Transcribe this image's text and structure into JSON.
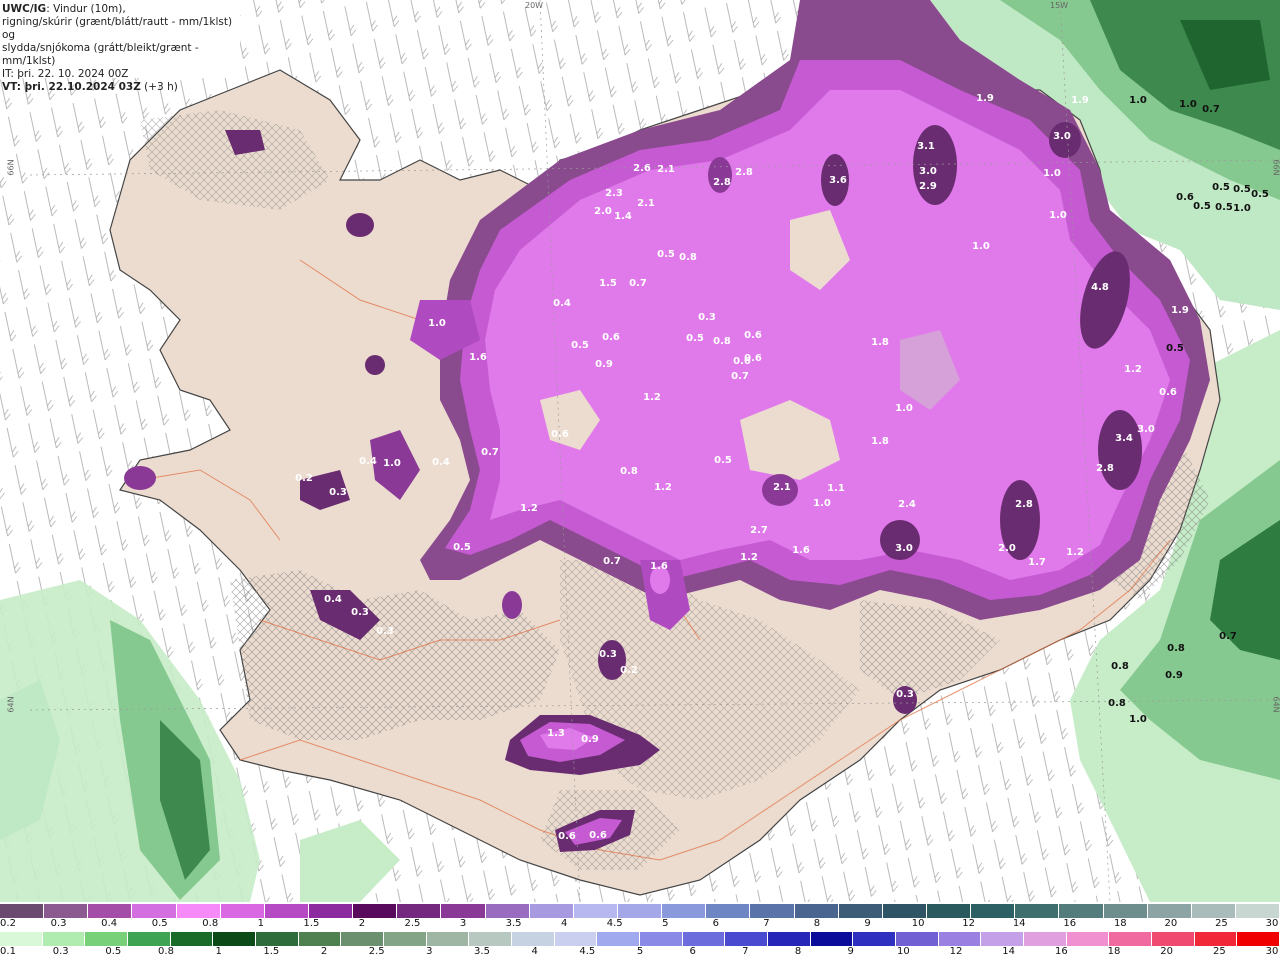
{
  "header": {
    "model": "UWC/IG",
    "line1_rest": ": Vindur (10m),",
    "line2": "rigning/skúrir (grænt/blátt/rautt - mm/1klst) og",
    "line3": "slydda/snjókoma (grátt/bleikt/grænt - mm/1klst)",
    "init_time": "IT: þri. 22. 10. 2024 00Z",
    "valid_time": "VT: þri. 22.10.2024 03Z",
    "lead": "(+3 h)"
  },
  "grid_labels": {
    "lon_20w": "20W",
    "lon_15w": "15W",
    "lat_66n_left": "66N",
    "lat_66n_right": "66N",
    "lat_64n_left": "64N",
    "lat_64n_right": "64N"
  },
  "colors": {
    "land": "#ecdcd0",
    "roads": "#e06030",
    "snow_purple": "#dd6ee8",
    "snow_dark": "#6a2c70",
    "snow_mid": "#a24aa8",
    "rain_green_light": "#b8ecc0",
    "rain_green_dark": "#2e7c40"
  },
  "precip_labels": [
    {
      "t": "3.1",
      "c": "w"
    },
    {
      "t": "3.0",
      "c": "w"
    },
    {
      "t": "2.9",
      "c": "w"
    },
    {
      "t": "3.6",
      "c": "w"
    },
    {
      "t": "2.8",
      "c": "w"
    },
    {
      "t": "2.8",
      "c": "w"
    },
    {
      "t": "2.6",
      "c": "w"
    },
    {
      "t": "2.1",
      "c": "w"
    },
    {
      "t": "2.3",
      "c": "w"
    },
    {
      "t": "2.0",
      "c": "w"
    },
    {
      "t": "1.4",
      "c": "w"
    },
    {
      "t": "2.1",
      "c": "w"
    },
    {
      "t": "1.9",
      "c": "w"
    },
    {
      "t": "1.9",
      "c": "w"
    },
    {
      "t": "3.0",
      "c": "w"
    },
    {
      "t": "1.0",
      "c": "w"
    },
    {
      "t": "1.0",
      "c": "w"
    },
    {
      "t": "1.0",
      "c": "w"
    },
    {
      "t": "4.8",
      "c": "w"
    },
    {
      "t": "1.9",
      "c": "w"
    },
    {
      "t": "3.4",
      "c": "w"
    },
    {
      "t": "3.0",
      "c": "w"
    },
    {
      "t": "2.8",
      "c": "w"
    },
    {
      "t": "2.8",
      "c": "w"
    },
    {
      "t": "2.0",
      "c": "w"
    },
    {
      "t": "1.7",
      "c": "w"
    },
    {
      "t": "1.2",
      "c": "w"
    },
    {
      "t": "2.4",
      "c": "w"
    },
    {
      "t": "3.0",
      "c": "w"
    },
    {
      "t": "2.1",
      "c": "w"
    },
    {
      "t": "2.7",
      "c": "w"
    },
    {
      "t": "1.0",
      "c": "w"
    },
    {
      "t": "1.1",
      "c": "w"
    },
    {
      "t": "1.2",
      "c": "w"
    },
    {
      "t": "1.6",
      "c": "w"
    },
    {
      "t": "1.8",
      "c": "w"
    },
    {
      "t": "1.8",
      "c": "w"
    },
    {
      "t": "1.0",
      "c": "w"
    },
    {
      "t": "1.2",
      "c": "w"
    },
    {
      "t": "0.5",
      "c": "w"
    },
    {
      "t": "0.8",
      "c": "w"
    },
    {
      "t": "1.2",
      "c": "w"
    },
    {
      "t": "1.2",
      "c": "w"
    },
    {
      "t": "1.6",
      "c": "w"
    },
    {
      "t": "1.0",
      "c": "w"
    },
    {
      "t": "0.7",
      "c": "w"
    },
    {
      "t": "0.5",
      "c": "w"
    },
    {
      "t": "0.4",
      "c": "w"
    },
    {
      "t": "1.0",
      "c": "w"
    },
    {
      "t": "0.4",
      "c": "w"
    },
    {
      "t": "0.3",
      "c": "w"
    },
    {
      "t": "0.2",
      "c": "w"
    },
    {
      "t": "0.4",
      "c": "w"
    },
    {
      "t": "0.3",
      "c": "w"
    },
    {
      "t": "0.3",
      "c": "w"
    },
    {
      "t": "1.3",
      "c": "w"
    },
    {
      "t": "0.9",
      "c": "w"
    },
    {
      "t": "0.6",
      "c": "w"
    },
    {
      "t": "0.6",
      "c": "w"
    },
    {
      "t": "0.3",
      "c": "w"
    },
    {
      "t": "0.2",
      "c": "w"
    },
    {
      "t": "0.3",
      "c": "w"
    },
    {
      "t": "1.6",
      "c": "w"
    },
    {
      "t": "0.7",
      "c": "w"
    },
    {
      "t": "1.5",
      "c": "w"
    },
    {
      "t": "0.7",
      "c": "w"
    },
    {
      "t": "0.5",
      "c": "w"
    },
    {
      "t": "0.8",
      "c": "w"
    },
    {
      "t": "0.4",
      "c": "w"
    },
    {
      "t": "0.3",
      "c": "w"
    },
    {
      "t": "0.6",
      "c": "w"
    },
    {
      "t": "0.6",
      "c": "w"
    },
    {
      "t": "0.5",
      "c": "w"
    },
    {
      "t": "0.6",
      "c": "w"
    },
    {
      "t": "0.8",
      "c": "w"
    },
    {
      "t": "0.6",
      "c": "w"
    },
    {
      "t": "0.5",
      "c": "w"
    },
    {
      "t": "0.6",
      "c": "w"
    },
    {
      "t": "0.7",
      "c": "w"
    },
    {
      "t": "0.9",
      "c": "w"
    },
    {
      "t": "1.2",
      "c": "w"
    },
    {
      "t": "0.6",
      "c": "w"
    },
    {
      "t": "0.5",
      "c": "k"
    },
    {
      "t": "0.5",
      "c": "k"
    },
    {
      "t": "0.5",
      "c": "k"
    },
    {
      "t": "0.5",
      "c": "k"
    },
    {
      "t": "0.6",
      "c": "k"
    },
    {
      "t": "0.5",
      "c": "k"
    },
    {
      "t": "0.5",
      "c": "k"
    },
    {
      "t": "1.0",
      "c": "k"
    },
    {
      "t": "1.0",
      "c": "k"
    },
    {
      "t": "1.0",
      "c": "k"
    },
    {
      "t": "0.7",
      "c": "k"
    },
    {
      "t": "0.8",
      "c": "k"
    },
    {
      "t": "0.8",
      "c": "k"
    },
    {
      "t": "0.9",
      "c": "k"
    },
    {
      "t": "0.8",
      "c": "k"
    },
    {
      "t": "1.0",
      "c": "k"
    },
    {
      "t": "0.7",
      "c": "k"
    }
  ],
  "legend": {
    "snow": {
      "colors": [
        "#6a4a6e",
        "#8a5a90",
        "#a44ea8",
        "#d36fe0",
        "#f58af8",
        "#d968e2",
        "#b54ac4",
        "#8d2aa0",
        "#5a0a5c",
        "#74287e",
        "#8a3a96",
        "#9a6cc0",
        "#a89ae0",
        "#b8b8f0",
        "#a4a8e8",
        "#8a98dc",
        "#6f86c4",
        "#5a74aa",
        "#4a6690",
        "#3c5c78",
        "#2e5466",
        "#2a5a5e",
        "#2c6064",
        "#3e6e6e",
        "#547c7c",
        "#6e8e8e",
        "#8ca4a4",
        "#aabcba",
        "#c8d6d2"
      ],
      "labels": [
        "0.2",
        "0.3",
        "0.4",
        "0.5",
        "0.8",
        "1",
        "1.5",
        "2",
        "2.5",
        "3",
        "3.5",
        "4",
        "4.5",
        "5",
        "6",
        "7",
        "8",
        "9",
        "10",
        "12",
        "14",
        "16",
        "18",
        "20",
        "25",
        "30"
      ]
    },
    "rain": {
      "colors": [
        "#d8f8d8",
        "#b0ecb0",
        "#78d078",
        "#3ea454",
        "#1a6a2a",
        "#0c4a18",
        "#2e6c3c",
        "#4e8050",
        "#6a9070",
        "#84a488",
        "#a0b6a4",
        "#b6c8c0",
        "#c6d2e2",
        "#cacff0",
        "#a0a8ee",
        "#8a8ae6",
        "#6c6cdc",
        "#4a4ad0",
        "#2626b8",
        "#0c0c9a",
        "#3030c0",
        "#7060d4",
        "#9a80e0",
        "#c4a0e8",
        "#e0a0e0",
        "#f090d0",
        "#f06aa0",
        "#f04a70",
        "#f02838",
        "#f00000"
      ],
      "labels": [
        "0.1",
        "0.3",
        "0.5",
        "0.8",
        "1",
        "1.5",
        "2",
        "2.5",
        "3",
        "3.5",
        "4",
        "4.5",
        "5",
        "6",
        "7",
        "8",
        "9",
        "10",
        "12",
        "14",
        "16",
        "18",
        "20",
        "25",
        "30"
      ]
    }
  }
}
